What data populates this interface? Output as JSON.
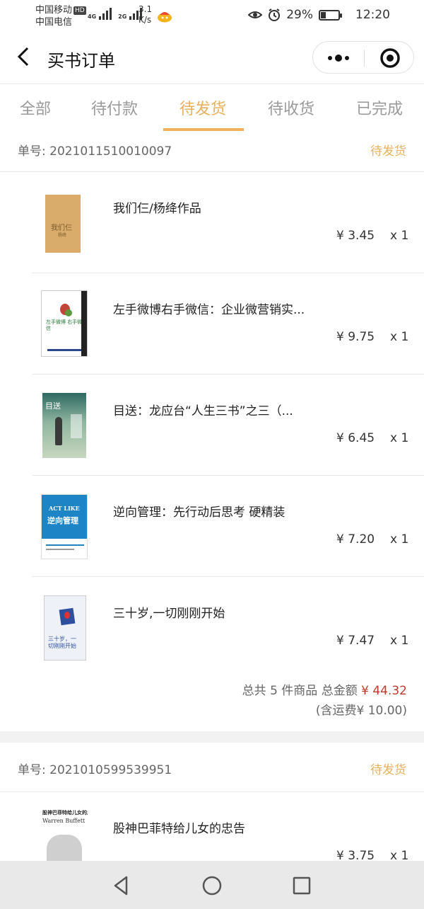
{
  "status_bar": {
    "carrier1": "中国移动",
    "hd": "HD",
    "carrier2": "中国电信",
    "sig1": "4G",
    "sig2": "2G",
    "speed_value": "3.1",
    "speed_unit": "K/s",
    "battery": "29%",
    "battery_level": 0.29,
    "time": "12:20"
  },
  "nav": {
    "title": "买书订单"
  },
  "tabs": [
    {
      "label": "全部"
    },
    {
      "label": "待付款"
    },
    {
      "label": "待发货",
      "active": true
    },
    {
      "label": "待收货"
    },
    {
      "label": "已完成"
    }
  ],
  "orders": [
    {
      "number": "单号: 2021011510010097",
      "status": "待发货",
      "items": [
        {
          "name": "我们仨/杨绛作品",
          "price": "¥ 3.45",
          "qty": "x 1",
          "cover_text": "我们仨",
          "cover_author": "杨绛"
        },
        {
          "name": "左手微博右手微信：企业微营销实...",
          "price": "¥ 9.75",
          "qty": "x 1",
          "cover_text": "左手微博 右手微信"
        },
        {
          "name": "目送：龙应台“人生三书”之三（...",
          "price": "¥ 6.45",
          "qty": "x 1",
          "cover_text": "目送"
        },
        {
          "name": "逆向管理：先行动后思考 硬精装",
          "price": "¥ 7.20",
          "qty": "x 1",
          "cover_text": "逆向管理",
          "cover_text_en": "ACT LIKE"
        },
        {
          "name": "三十岁,一切刚刚开始",
          "price": "¥ 7.47",
          "qty": "x 1",
          "cover_text": "三十岁，一切刚刚开始"
        }
      ],
      "summary_prefix": "总共 5 件商品 总金额",
      "total": "¥ 44.32",
      "shipping": "(含运费¥ 10.00)"
    },
    {
      "number": "单号: 2021010599539951",
      "status": "待发货",
      "items": [
        {
          "name": "股神巴菲特给儿女的忠告",
          "price": "¥ 3.75",
          "qty": "x 1",
          "cover_text": "股神巴菲特给儿女的忠告",
          "cover_text_en": "Warren Buffett"
        }
      ]
    }
  ],
  "icons": {
    "back": "back-arrow-icon",
    "more": "more-dots-icon",
    "close": "target-circle-icon",
    "sys_back": "triangle-back-icon",
    "sys_home": "circle-home-icon",
    "sys_recent": "square-recent-icon"
  },
  "colors": {
    "accent": "#e8b05a",
    "price_red": "#c0392b",
    "tab_inactive": "#9a9a9a"
  }
}
